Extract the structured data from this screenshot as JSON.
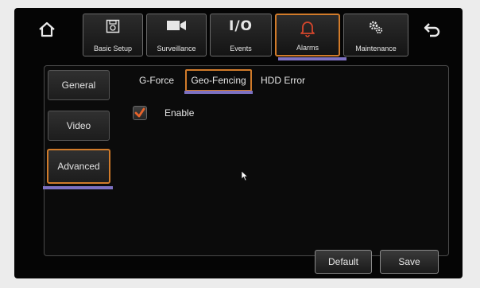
{
  "toolbar": {
    "tabs": [
      {
        "label": "Basic Setup",
        "icon": "disk-icon"
      },
      {
        "label": "Surveillance",
        "icon": "camera-icon"
      },
      {
        "label": "Events",
        "icon": "io-icon",
        "glyph": "I/O"
      },
      {
        "label": "Alarms",
        "icon": "bell-icon",
        "active": true
      },
      {
        "label": "Maintenance",
        "icon": "gears-icon"
      }
    ]
  },
  "sidebar": {
    "items": [
      {
        "label": "General"
      },
      {
        "label": "Video"
      },
      {
        "label": "Advanced",
        "active": true
      }
    ]
  },
  "subtabs": [
    {
      "label": "G-Force"
    },
    {
      "label": "Geo-Fencing",
      "active": true
    },
    {
      "label": "HDD Error"
    }
  ],
  "settings": {
    "enable_label": "Enable",
    "enable_checked": true
  },
  "buttons": {
    "default_label": "Default",
    "save_label": "Save"
  },
  "colors": {
    "active_border": "#d17b2a",
    "underline": "#7d71c2",
    "check": "#e8632a"
  }
}
